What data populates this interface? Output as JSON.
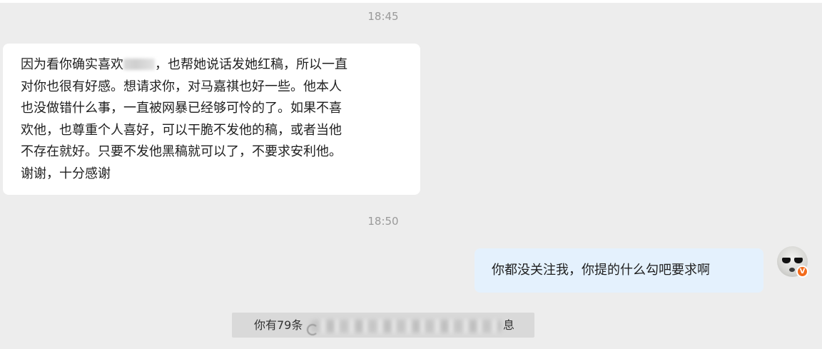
{
  "chat": {
    "timestamp_1": "18:45",
    "incoming_message_lines": [
      "因为看你确实喜欢",
      "，也帮她说话发她红稿，所以一直",
      "对你也很有好感。想请求你，对马嘉祺也好一些。他本人",
      "也没做错什么事，一直被网暴已经够可怜的了。如果不喜",
      "欢他，也尊重个人喜好，可以干脆不发他的稿，或者当他",
      "不存在就好。只要不发他黑稿就可以了，不要求安利他。",
      "谢谢，十分感谢"
    ],
    "timestamp_2": "18:50",
    "outgoing_message": "你都没关注我，你提的什么勾吧要求啊",
    "avatar_badge": "V"
  },
  "notice": {
    "prefix": "你有79条",
    "suffix": "息"
  },
  "colors": {
    "background": "#ededed",
    "incoming_bubble": "#ffffff",
    "outgoing_bubble": "#e4f1fd",
    "verified_badge": "#f36b1c"
  }
}
